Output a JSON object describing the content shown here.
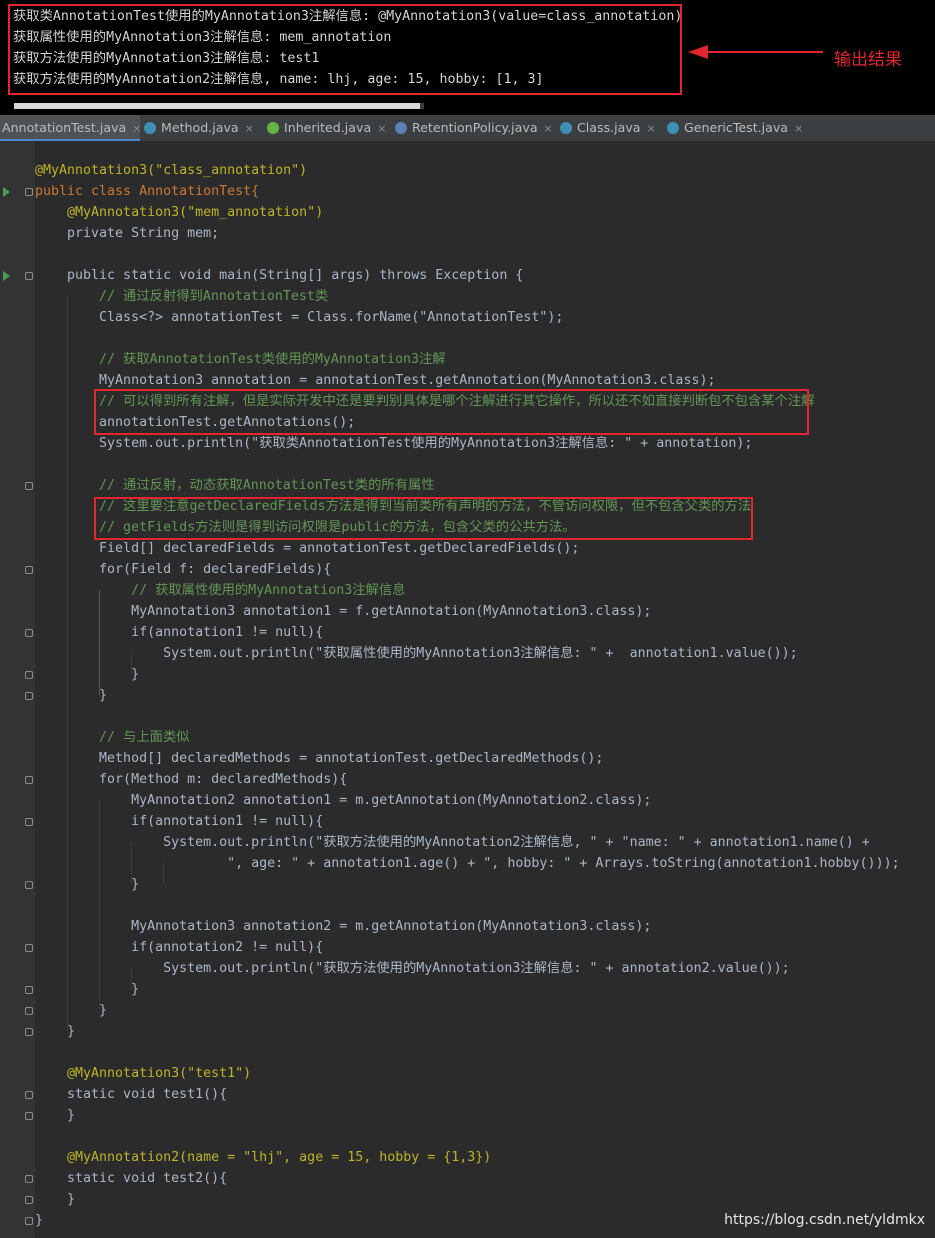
{
  "console": {
    "lines": [
      "获取类AnnotationTest使用的MyAnnotation3注解信息: @MyAnnotation3(value=class_annotation)",
      "获取属性使用的MyAnnotation3注解信息: mem_annotation",
      "获取方法使用的MyAnnotation3注解信息: test1",
      "获取方法使用的MyAnnotation2注解信息, name: lhj, age: 15, hobby: [1, 3]"
    ],
    "annotation_label": "输出结果"
  },
  "tabs": [
    {
      "label": "AnnotationTest.java",
      "icon": "class-icon",
      "active": true
    },
    {
      "label": "Method.java",
      "icon": "class-icon",
      "active": false
    },
    {
      "label": "Inherited.java",
      "icon": "annotation-icon",
      "active": false
    },
    {
      "label": "RetentionPolicy.java",
      "icon": "enum-icon",
      "active": false
    },
    {
      "label": "Class.java",
      "icon": "class-icon",
      "active": false
    },
    {
      "label": "GenericTest.java",
      "icon": "class-icon",
      "active": false
    }
  ],
  "tab_close_glyph": "×",
  "code": {
    "l01": "@MyAnnotation3(\"class_annotation\")",
    "l02": "public class AnnotationTest{",
    "l03": "    @MyAnnotation3(\"mem_annotation\")",
    "l04": "    private String mem;",
    "l06": "    public static void main(String[] args) throws Exception {",
    "l07": "        // 通过反射得到AnnotationTest类",
    "l08": "        Class<?> annotationTest = Class.forName(\"AnnotationTest\");",
    "l10": "        // 获取AnnotationTest类使用的MyAnnotation3注解",
    "l11": "        MyAnnotation3 annotation = annotationTest.getAnnotation(MyAnnotation3.class);",
    "l12": "        // 可以得到所有注解，但是实际开发中还是要判别具体是哪个注解进行其它操作，所以还不如直接判断包不包含某个注解",
    "l13": "        annotationTest.getAnnotations();",
    "l14": "        System.out.println(\"获取类AnnotationTest使用的MyAnnotation3注解信息: \" + annotation);",
    "l16": "        // 通过反射，动态获取AnnotationTest类的所有属性",
    "l17": "        // 这里要注意getDeclaredFields方法是得到当前类所有声明的方法，不管访问权限，但不包含父类的方法",
    "l18": "        // getFields方法则是得到访问权限是public的方法，包含父类的公共方法。",
    "l19": "        Field[] declaredFields = annotationTest.getDeclaredFields();",
    "l20": "        for(Field f: declaredFields){",
    "l21": "            // 获取属性使用的MyAnnotation3注解信息",
    "l22": "            MyAnnotation3 annotation1 = f.getAnnotation(MyAnnotation3.class);",
    "l23": "            if(annotation1 != null){",
    "l24": "                System.out.println(\"获取属性使用的MyAnnotation3注解信息: \" +  annotation1.value());",
    "l25": "            }",
    "l26": "        }",
    "l28": "        // 与上面类似",
    "l29": "        Method[] declaredMethods = annotationTest.getDeclaredMethods();",
    "l30": "        for(Method m: declaredMethods){",
    "l31": "            MyAnnotation2 annotation1 = m.getAnnotation(MyAnnotation2.class);",
    "l32": "            if(annotation1 != null){",
    "l33": "                System.out.println(\"获取方法使用的MyAnnotation2注解信息, \" + \"name: \" + annotation1.name() +",
    "l34": "                        \", age: \" + annotation1.age() + \", hobby: \" + Arrays.toString(annotation1.hobby()));",
    "l35": "            }",
    "l37": "            MyAnnotation3 annotation2 = m.getAnnotation(MyAnnotation3.class);",
    "l38": "            if(annotation2 != null){",
    "l39": "                System.out.println(\"获取方法使用的MyAnnotation3注解信息: \" + annotation2.value());",
    "l40": "            }",
    "l41": "        }",
    "l42": "    }",
    "l44": "    @MyAnnotation3(\"test1\")",
    "l45": "    static void test1(){",
    "l46": "    }",
    "l48": "    @MyAnnotation2(name = \"lhj\", age = 15, hobby = {1,3})",
    "l49": "    static void test2(){",
    "l50": "    }",
    "l51": "}"
  },
  "watermark": "https://blog.csdn.net/yldmkx",
  "colors": {
    "highlight_box": "#e0272d",
    "editor_bg": "#2b2b2b",
    "keyword": "#cc7832",
    "annotation": "#bbb529",
    "string": "#6a8759",
    "comment": "#6897bb"
  }
}
